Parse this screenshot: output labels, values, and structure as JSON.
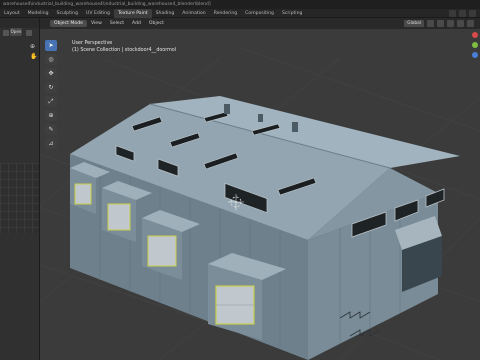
{
  "window": {
    "title": "warehouse4\\industrial_building_warehouse4\\industrial_building_warehouse4_blender\\blend]"
  },
  "workspace_tabs": [
    {
      "label": "Layout"
    },
    {
      "label": "Modeling"
    },
    {
      "label": "Sculpting"
    },
    {
      "label": "UV Editing"
    },
    {
      "label": "Texture Paint"
    },
    {
      "label": "Shading"
    },
    {
      "label": "Animation"
    },
    {
      "label": "Rendering"
    },
    {
      "label": "Compositing"
    },
    {
      "label": "Scripting"
    }
  ],
  "active_tab": "Texture Paint",
  "left_panel": {
    "open_button": "Open"
  },
  "viewport": {
    "mode": "Object Mode",
    "menus": [
      "View",
      "Select",
      "Add",
      "Object"
    ],
    "transform_orientation": "Global",
    "overlay_line1": "User Perspective",
    "overlay_line2": "(1) Scene Collection | stockdoor4__doormol"
  },
  "toolbar_icons": [
    "select-cursor-icon",
    "cursor-icon",
    "move-icon",
    "rotate-icon",
    "scale-icon",
    "transform-icon",
    "annotate-icon",
    "measure-icon"
  ],
  "colors": {
    "viewport_bg": "#3b3b3b",
    "active_tab": "#3d3d3d",
    "active_tool": "#4772b3",
    "roof": "#8ea1ad",
    "wall": "#7f929e",
    "trim": "#c8cf4a"
  }
}
